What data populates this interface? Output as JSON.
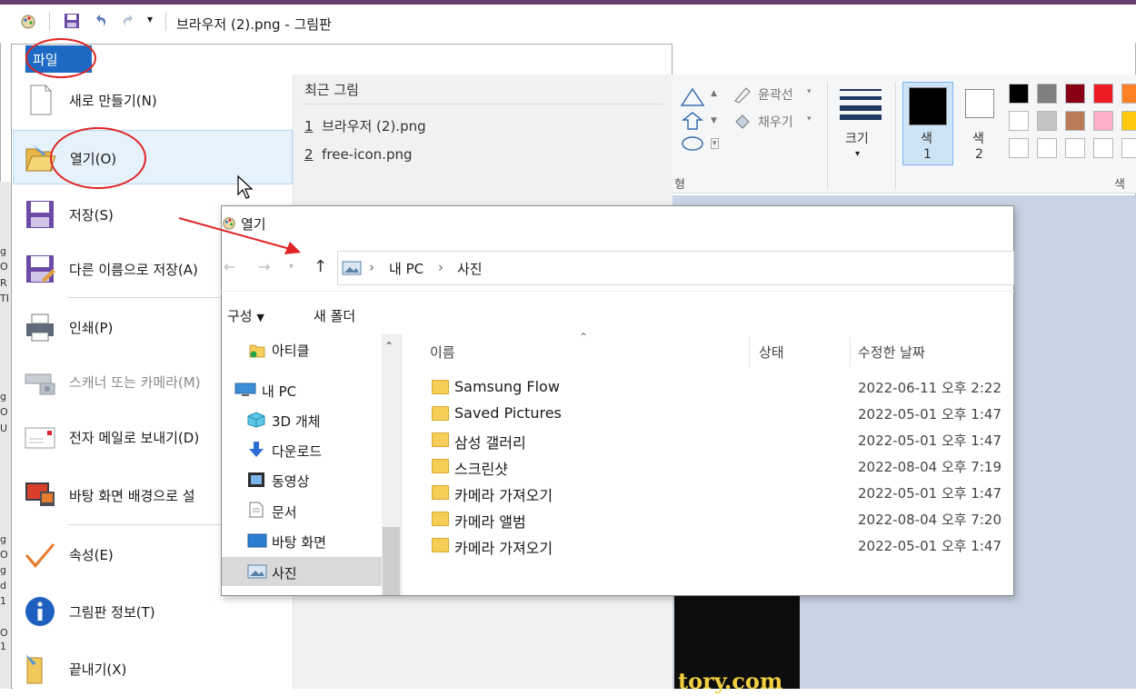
{
  "window": {
    "title": "브라우저 (2).png - 그림판"
  },
  "file_menu": {
    "tab_label": "파일",
    "items": [
      {
        "label": "새로 만들기(N)",
        "icon": "new-file-icon",
        "enabled": true
      },
      {
        "label": "열기(O)",
        "icon": "open-folder-icon",
        "enabled": true
      },
      {
        "label": "저장(S)",
        "icon": "floppy-save-icon",
        "enabled": true
      },
      {
        "label": "다른 이름으로 저장(A)",
        "icon": "save-as-icon",
        "enabled": true
      },
      {
        "label": "인쇄(P)",
        "icon": "printer-icon",
        "enabled": true
      },
      {
        "label": "스캐너 또는 카메라(M)",
        "icon": "scanner-icon",
        "enabled": false
      },
      {
        "label": "전자 메일로 보내기(D)",
        "icon": "email-icon",
        "enabled": true
      },
      {
        "label": "바탕 화면 배경으로 설",
        "icon": "desktop-background-icon",
        "enabled": true
      },
      {
        "label": "속성(E)",
        "icon": "checkmark-icon",
        "enabled": true
      },
      {
        "label": "그림판 정보(T)",
        "icon": "info-icon",
        "enabled": true
      },
      {
        "label": "끝내기(X)",
        "icon": "exit-icon",
        "enabled": true
      }
    ],
    "recent_title": "최근 그림",
    "recent": [
      {
        "num": "1",
        "name": "브라우저 (2).png"
      },
      {
        "num": "2",
        "name": "free-icon.png"
      }
    ]
  },
  "ribbon": {
    "outline_label": "윤곽선",
    "fill_label": "채우기",
    "shapes_group_partial": "형",
    "size_label": "크기",
    "color1_label": "색",
    "color1_num": "1",
    "color2_label": "색",
    "color2_num": "2",
    "colors_group_partial": "색",
    "palette": [
      "#000000",
      "#7f7f7f",
      "#880015",
      "#ed1c24",
      "#ff7f27",
      "#ffffff",
      "#c3c3c3",
      "#b97a57",
      "#ffaec9",
      "#ffc90e",
      "#ffffff",
      "#ffffff",
      "#ffffff",
      "#ffffff",
      "#ffffff"
    ]
  },
  "open_dialog": {
    "title": "열기",
    "breadcrumb": [
      "내 PC",
      "사진"
    ],
    "toolbar": {
      "organize": "구성",
      "new_folder": "새 폴더"
    },
    "nav": [
      {
        "label": "아티클",
        "icon": "folder-sync-icon"
      },
      {
        "label": "내 PC",
        "icon": "computer-icon"
      },
      {
        "label": "3D 개체",
        "icon": "cube-3d-icon"
      },
      {
        "label": "다운로드",
        "icon": "download-arrow-icon"
      },
      {
        "label": "동영상",
        "icon": "video-icon"
      },
      {
        "label": "문서",
        "icon": "document-icon"
      },
      {
        "label": "바탕 화면",
        "icon": "desktop-icon"
      },
      {
        "label": "사진",
        "icon": "pictures-icon"
      }
    ],
    "columns": {
      "name": "이름",
      "status": "상태",
      "modified": "수정한 날짜"
    },
    "files": [
      {
        "name": "Samsung Flow",
        "modified": "2022-06-11 오후 2:22"
      },
      {
        "name": "Saved Pictures",
        "modified": "2022-05-01 오후 1:47"
      },
      {
        "name": "삼성 갤러리",
        "modified": "2022-05-01 오후 1:47"
      },
      {
        "name": "스크린샷",
        "modified": "2022-08-04 오후 7:19"
      },
      {
        "name": "카메라 가져오기",
        "modified": "2022-05-01 오후 1:47"
      },
      {
        "name": "카메라 앨범",
        "modified": "2022-08-04 오후 7:20"
      },
      {
        "name": "카메라 가져오기",
        "modified": "2022-05-01 오후 1:47"
      }
    ]
  },
  "canvas": {
    "watermark": "tory.com"
  },
  "left_strip_fragments": [
    "g",
    "O",
    "R",
    "TI",
    "g",
    "O",
    "U",
    "g",
    "O",
    "g",
    "d",
    "1",
    "O",
    "1"
  ],
  "colors": {
    "file_tab": "#1e69c4",
    "highlight": "#e5f1fb",
    "annotation": "#e02424"
  }
}
